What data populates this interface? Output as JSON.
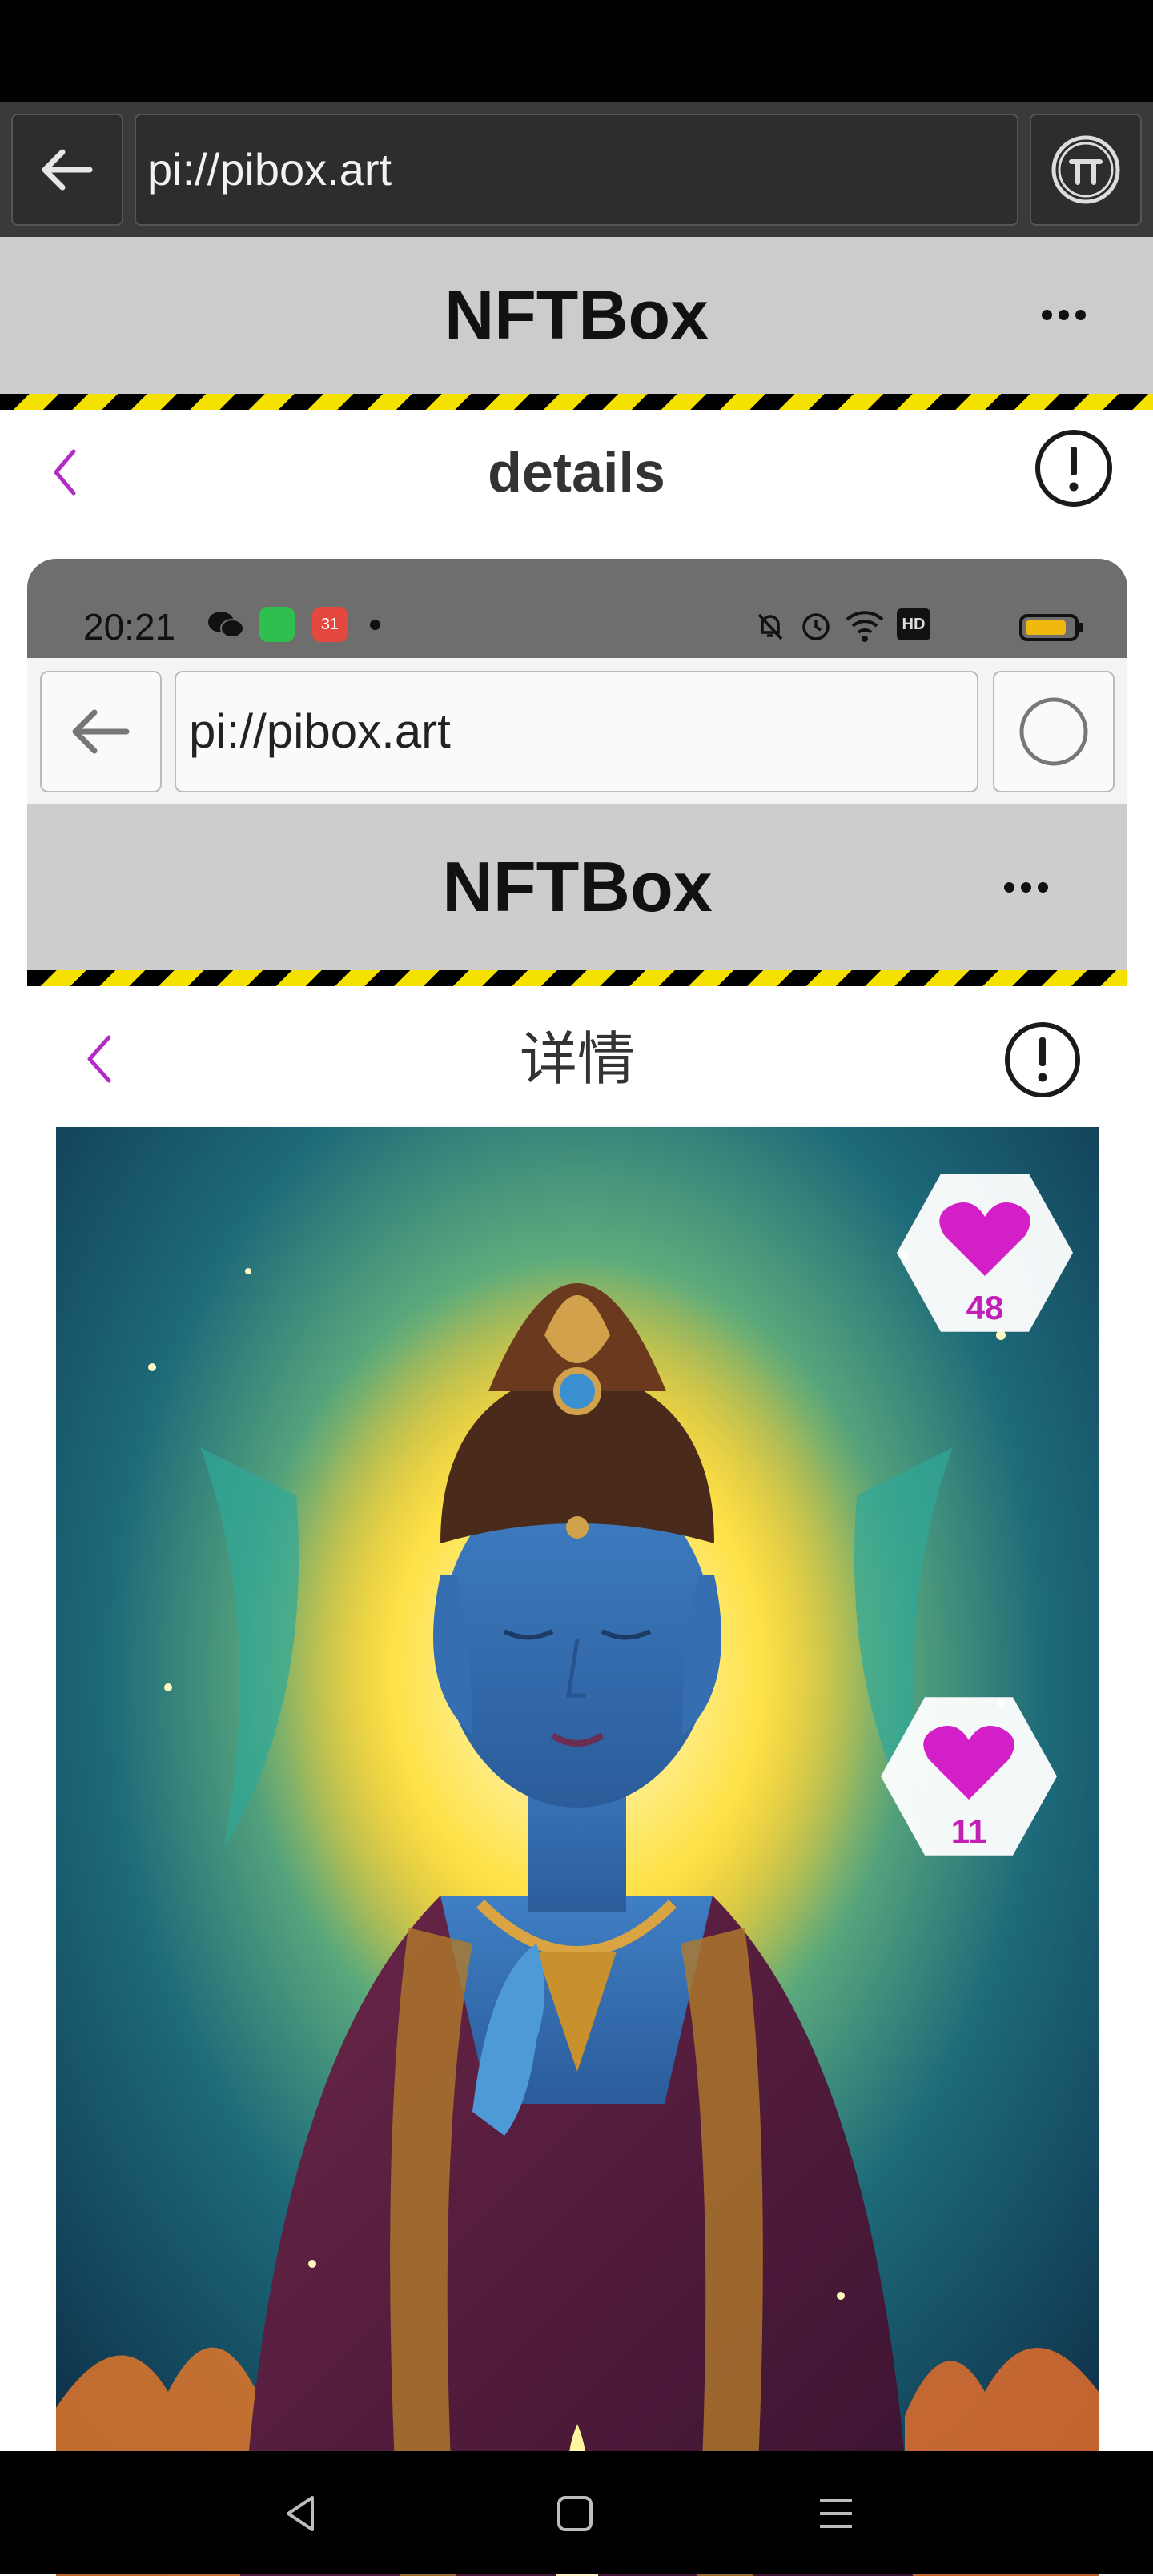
{
  "browser": {
    "url": "pi://pibox.art"
  },
  "header": {
    "title": "NFTBox"
  },
  "page": {
    "title": "details"
  },
  "inner_screenshot": {
    "time": "20:21",
    "url": "pi://pibox.art",
    "title": "NFTBox",
    "details_title": "详情",
    "outer_like_count": "48",
    "artwork_like_count": "11",
    "notification_badge": "31"
  },
  "colors": {
    "accent": "#c21fb6",
    "hazard_yellow": "#f5e100",
    "header_gray": "#cccccc"
  }
}
